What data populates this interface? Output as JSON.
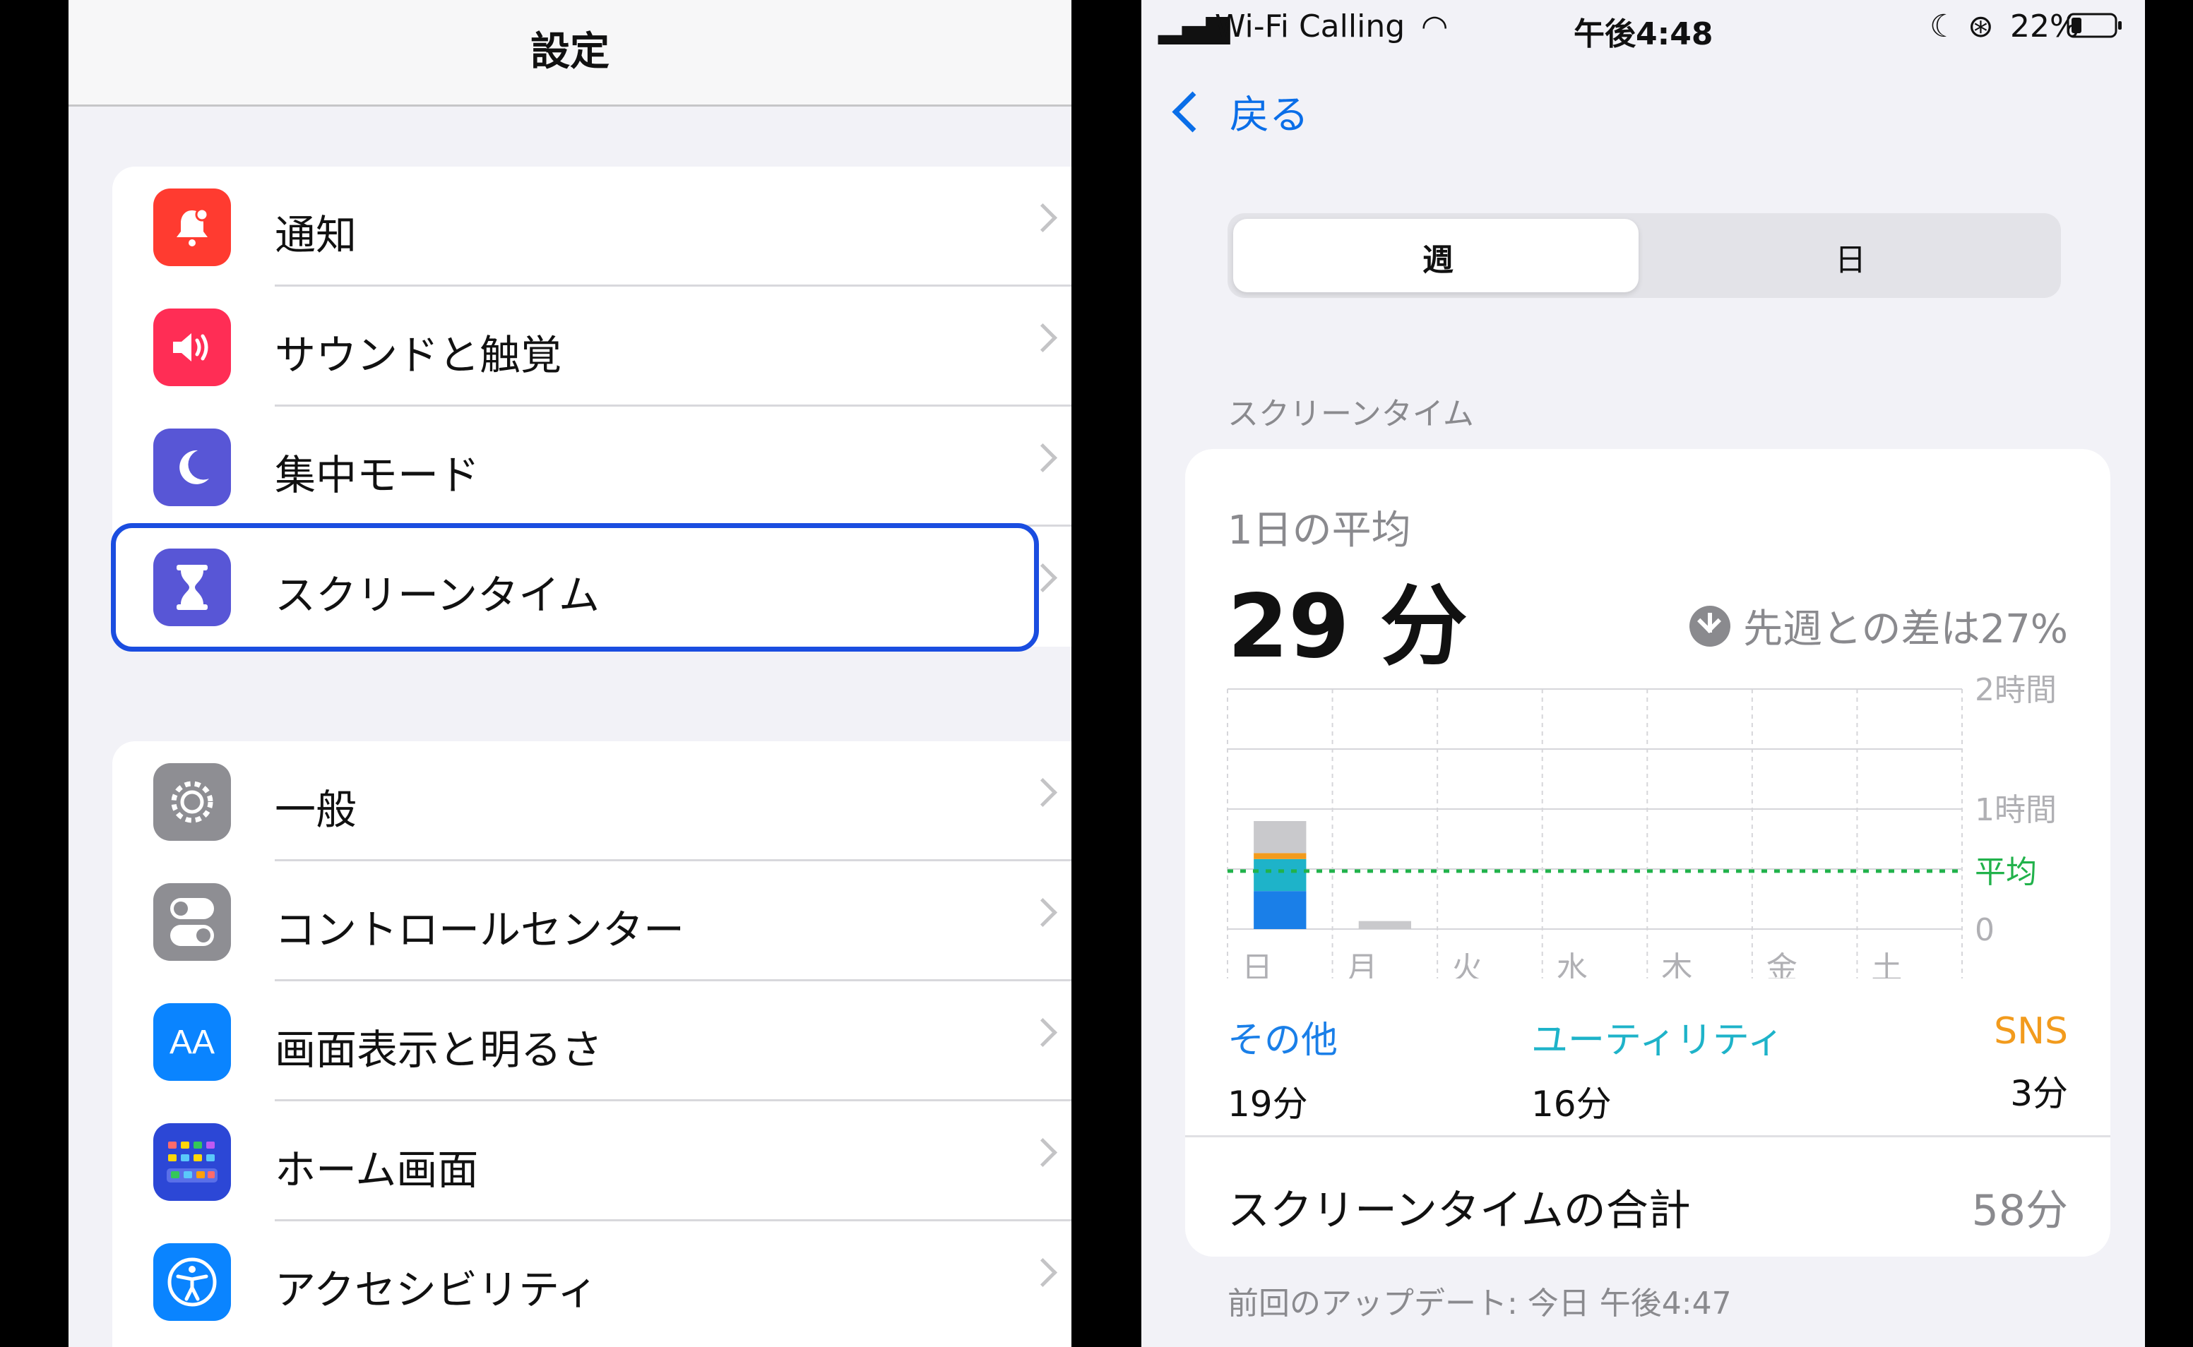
{
  "settings": {
    "title": "設定",
    "group1": [
      {
        "label": "通知",
        "icon": "bell-icon",
        "color": "#ff3b30"
      },
      {
        "label": "サウンドと触覚",
        "icon": "speaker-icon",
        "color": "#ff2d55"
      },
      {
        "label": "集中モード",
        "icon": "moon-icon",
        "color": "#5856d6"
      },
      {
        "label": "スクリーンタイム",
        "icon": "hourglass-icon",
        "color": "#5856d6",
        "selected": true
      }
    ],
    "group2": [
      {
        "label": "一般",
        "icon": "gear-icon",
        "color": "#8e8e93"
      },
      {
        "label": "コントロールセンター",
        "icon": "toggle-icon",
        "color": "#8e8e93"
      },
      {
        "label": "画面表示と明るさ",
        "icon": "text-size-icon",
        "color": "#0a84ff"
      },
      {
        "label": "ホーム画面",
        "icon": "home-grid-icon",
        "color": "#2c47d6"
      },
      {
        "label": "アクセシビリティ",
        "icon": "accessibility-icon",
        "color": "#0a84ff"
      }
    ]
  },
  "status": {
    "carrier": "Wi-Fi Calling",
    "time": "午後4:48",
    "battery": "22%"
  },
  "screen_time": {
    "back": "戻る",
    "segments": [
      "週",
      "日"
    ],
    "selected_segment": "週",
    "section": "スクリーンタイム",
    "avg_label": "1日の平均",
    "avg_value": "29 分",
    "delta": "先週との差は27%",
    "categories": [
      {
        "name": "その他",
        "value": "19分",
        "color": "#1a7fe8"
      },
      {
        "name": "ユーティリティ",
        "value": "16分",
        "color": "#1eb3c9"
      },
      {
        "name": "SNS",
        "value": "3分",
        "color": "#f29b1d"
      }
    ],
    "total_label": "スクリーンタイムの合計",
    "total_value": "58分",
    "updated": "前回のアップデート: 今日 午後4:47"
  },
  "chart_data": {
    "type": "bar",
    "stacked": true,
    "categories": [
      "日",
      "月",
      "火",
      "水",
      "木",
      "金",
      "土"
    ],
    "y_tick_labels": [
      "2時間",
      "1時間",
      "0"
    ],
    "y_ticks_minutes": [
      120,
      60,
      0
    ],
    "ylim": [
      0,
      120
    ],
    "average_label": "平均",
    "average_minutes": 29,
    "grid": true,
    "series": [
      {
        "name": "その他",
        "color": "#1a7fe8",
        "values": [
          19,
          0,
          0,
          0,
          0,
          0,
          0
        ]
      },
      {
        "name": "ユーティリティ",
        "color": "#1eb3c9",
        "values": [
          16,
          0,
          0,
          0,
          0,
          0,
          0
        ]
      },
      {
        "name": "SNS",
        "color": "#f29b1d",
        "values": [
          3,
          0,
          0,
          0,
          0,
          0,
          0
        ]
      },
      {
        "color": "#c9c9cc",
        "values": [
          16,
          4,
          0,
          0,
          0,
          0,
          0
        ]
      }
    ]
  }
}
